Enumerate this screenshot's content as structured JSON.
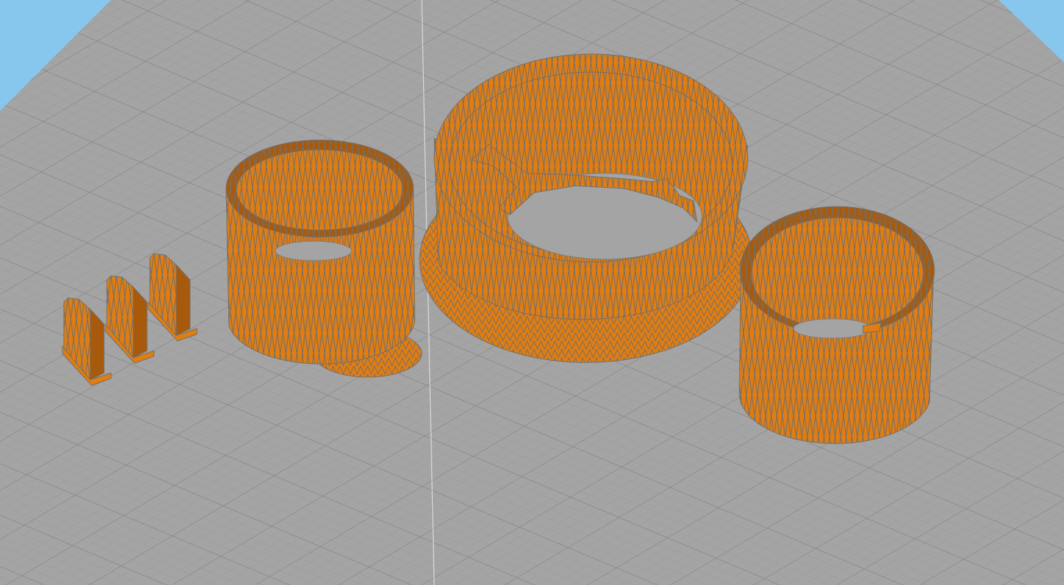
{
  "viewport": {
    "role": "3d-slicer-build-plate-view",
    "projection": "perspective",
    "grid": true,
    "colors": {
      "sky": "#87c7ee",
      "plate": "#a4a4a4",
      "grid_minor": "#979797",
      "grid_major": "#7e7e7e",
      "model_fill": "#e07d12",
      "model_shade": "#a85a0c",
      "model_edge": "#6f6f6f"
    },
    "models": [
      {
        "name": "clip",
        "count": 3,
        "shape": "wedge-bracket"
      },
      {
        "name": "cylinder-cup",
        "shape": "open-cylinder-with-foot"
      },
      {
        "name": "oval-ring-with-flange",
        "shape": "oval-ring-with-inner-spokes"
      },
      {
        "name": "cylinder-cup",
        "shape": "open-cylinder"
      }
    ]
  }
}
